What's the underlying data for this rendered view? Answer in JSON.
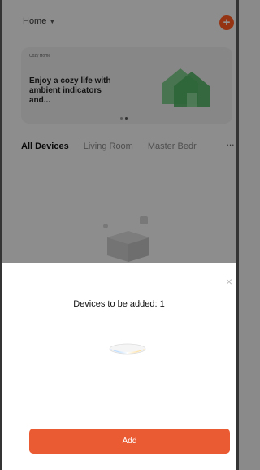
{
  "header": {
    "home_label": "Home",
    "home_dropdown_icon": "chevron-down-icon",
    "add_icon": "plus-circle-icon",
    "add_glyph": "+"
  },
  "banner": {
    "tag": "Cozy Home",
    "text": "Enjoy a cozy life with ambient indicators and...",
    "illustration": "house-illustration"
  },
  "tabs": [
    {
      "label": "All Devices",
      "active": true
    },
    {
      "label": "Living Room",
      "active": false
    },
    {
      "label": "Master Bedroom",
      "active": false
    }
  ],
  "tabs_more_icon": "more-horizontal-icon",
  "tabs_more_glyph": "···",
  "empty_state_illustration": "empty-box-illustration",
  "sheet": {
    "close_icon": "close-icon",
    "close_glyph": "×",
    "title": "Devices to be added: 1",
    "device_image": "ceiling-light-icon",
    "add_button_label": "Add"
  },
  "colors": {
    "accent": "#ea5b33",
    "fab": "#ff5a1f",
    "overlay": "rgba(0,0,0,0.42)"
  }
}
